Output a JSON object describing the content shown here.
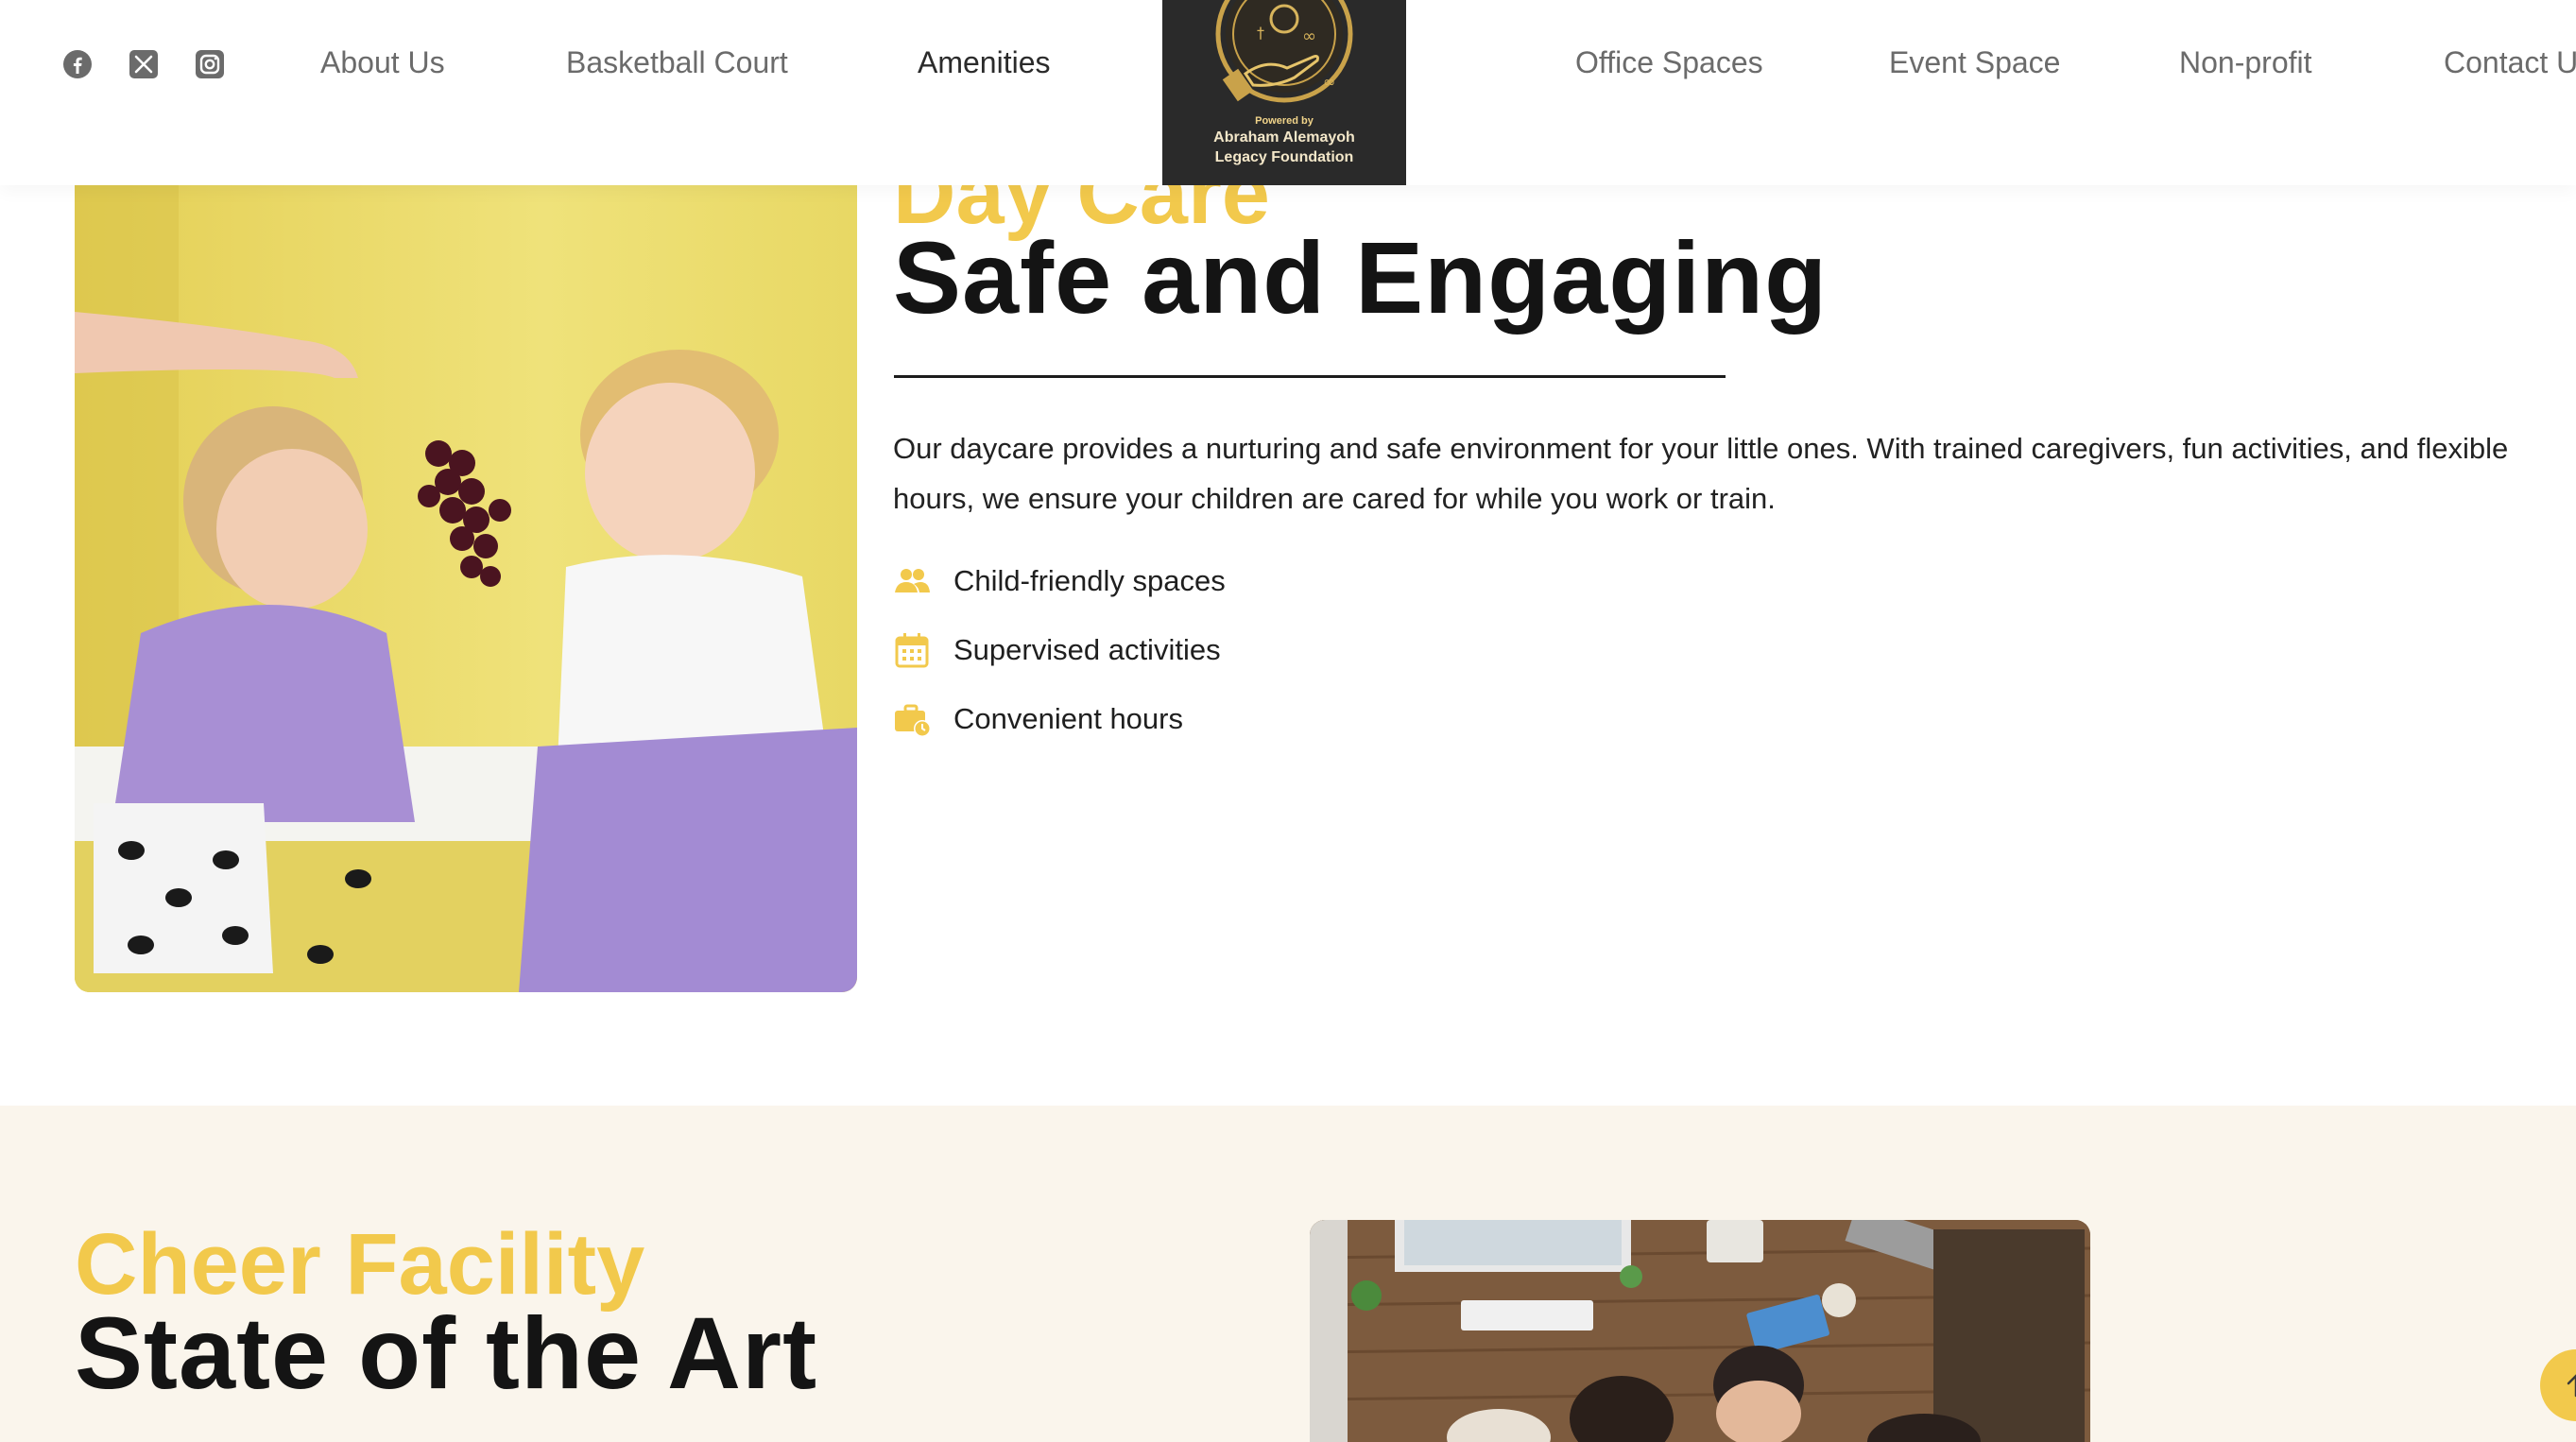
{
  "header": {
    "social": [
      {
        "icon": "facebook-icon"
      },
      {
        "icon": "x-twitter-icon"
      },
      {
        "icon": "instagram-icon"
      }
    ],
    "nav_left": [
      {
        "label": "About Us"
      },
      {
        "label": "Basketball Court"
      },
      {
        "label": "Amenities",
        "active": true
      }
    ],
    "nav_right": [
      {
        "label": "Office Spaces"
      },
      {
        "label": "Event Space"
      },
      {
        "label": "Non-profit"
      },
      {
        "label": "Contact U"
      }
    ],
    "logo": {
      "powered_by": "Powered by",
      "foundation_line1": "Abraham Alemayoh",
      "foundation_line2": "Legacy Foundation"
    }
  },
  "daycare": {
    "eyebrow": "Day Care",
    "title": "Safe and Engaging",
    "description": "Our daycare provides a nurturing and safe environment for your little ones. With trained caregivers, fun activities, and flexible hours, we ensure your children are cared for while you work or train.",
    "features": [
      {
        "icon": "users-icon",
        "label": "Child-friendly spaces"
      },
      {
        "icon": "calendar-icon",
        "label": "Supervised activities"
      },
      {
        "icon": "briefcase-clock-icon",
        "label": "Convenient hours"
      }
    ]
  },
  "cheer": {
    "eyebrow": "Cheer Facility",
    "title": "State of the Art"
  },
  "colors": {
    "accent": "#f2c94c",
    "heading": "#141414",
    "nav_text": "#6b6b6b",
    "section_bg": "#faf5ec",
    "logo_bg": "#2a2a2a"
  },
  "scroll_top": {
    "icon": "arrow-up-icon"
  }
}
